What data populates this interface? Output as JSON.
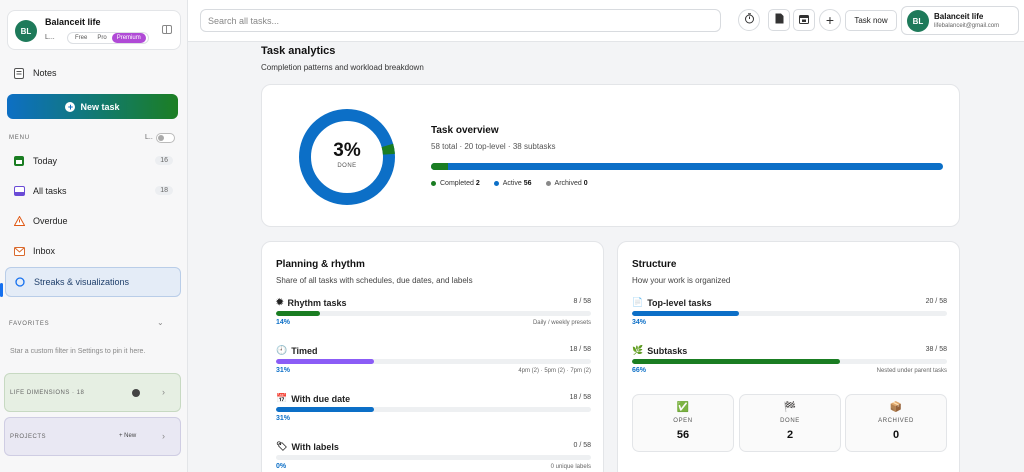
{
  "account": {
    "initials": "BL",
    "name": "Balanceit life",
    "short": "L...",
    "plans": [
      "Free",
      "Pro",
      "Premium"
    ]
  },
  "sidebar": {
    "notes_label": "Notes",
    "new_task_label": "New task",
    "menu_label": "MENU",
    "menu_short": "L..",
    "items": [
      {
        "label": "Today",
        "count": "16",
        "icon": "calendar-icon"
      },
      {
        "label": "All tasks",
        "count": "18",
        "icon": "inbox-tray-icon"
      },
      {
        "label": "Overdue",
        "count": "",
        "icon": "warning-icon"
      },
      {
        "label": "Inbox",
        "count": "",
        "icon": "mail-icon"
      },
      {
        "label": "Streaks & visualizations",
        "count": "",
        "icon": "circle-icon"
      }
    ],
    "favorites_label": "FAVORITES",
    "favorites_hint": "Star a custom filter in Settings to pin it here.",
    "life_dimensions_label": "LIFE DIMENSIONS · 18",
    "projects_label": "PROJECTS",
    "projects_new": "+ New"
  },
  "topbar": {
    "search_placeholder": "Search all tasks...",
    "task_now_label": "Task now",
    "user_initials": "BL",
    "user_name": "Balanceit life",
    "user_email": "lifebalanceit@gmail.com"
  },
  "main": {
    "title": "Task analytics",
    "subtitle": "Completion patterns and workload breakdown"
  },
  "overview": {
    "percent_label": "3%",
    "done_label": "DONE",
    "done_fraction": 0.034,
    "title": "Task overview",
    "summary": "58 total · 20 top-level · 38 subtasks",
    "legend": [
      {
        "label": "Completed",
        "value": "2",
        "color": "#1a7d22"
      },
      {
        "label": "Active",
        "value": "56",
        "color": "#0c6fc7"
      },
      {
        "label": "Archived",
        "value": "0",
        "color": "#888888"
      }
    ]
  },
  "planning": {
    "title": "Planning & rhythm",
    "subtitle": "Share of all tasks with schedules, due dates, and labels",
    "metrics": [
      {
        "icon": "sun-icon",
        "glyph": "✹",
        "label": "Rhythm tasks",
        "fraction": "8 / 58",
        "percent": "14%",
        "value": 0.14,
        "note": "Daily / weekly presets",
        "color": "#1a7d22"
      },
      {
        "icon": "clock-icon",
        "glyph": "🕘",
        "label": "Timed",
        "fraction": "18 / 58",
        "percent": "31%",
        "value": 0.31,
        "note": "4pm (2) · 5pm (2) · 7pm (2)",
        "color": "#8b5cf6"
      },
      {
        "icon": "calendar-icon",
        "glyph": "📅",
        "label": "With due date",
        "fraction": "18 / 58",
        "percent": "31%",
        "value": 0.31,
        "note": "",
        "color": "#0c6fc7"
      },
      {
        "icon": "tag-icon",
        "glyph": "🏷",
        "label": "With labels",
        "fraction": "0 / 58",
        "percent": "0%",
        "value": 0,
        "note": "0 unique labels",
        "color": "#0c6fc7"
      }
    ]
  },
  "structure": {
    "title": "Structure",
    "subtitle": "How your work is organized",
    "metrics": [
      {
        "icon": "document-icon",
        "glyph": "📄",
        "label": "Top-level tasks",
        "fraction": "20 / 58",
        "percent": "34%",
        "value": 0.34,
        "note": "",
        "color": "#0c6fc7"
      },
      {
        "icon": "seedling-icon",
        "glyph": "🌿",
        "label": "Subtasks",
        "fraction": "38 / 58",
        "percent": "66%",
        "value": 0.66,
        "note": "Nested under parent tasks",
        "color": "#1a7d22"
      }
    ],
    "stats": [
      {
        "icon": "check-box-icon",
        "glyph": "✅",
        "label": "OPEN",
        "value": "56"
      },
      {
        "icon": "checkered-flag-icon",
        "glyph": "🏁",
        "label": "DONE",
        "value": "2"
      },
      {
        "icon": "package-icon",
        "glyph": "📦",
        "label": "ARCHIVED",
        "value": "0"
      }
    ]
  }
}
